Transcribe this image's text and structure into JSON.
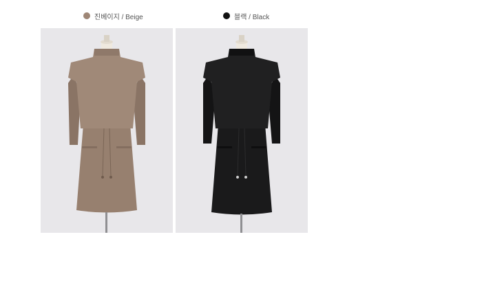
{
  "colors": [
    {
      "label": "진베이지 / Beige",
      "swatch": "#9e8676",
      "garment": "#97806f",
      "garment_dark": "#846e5f",
      "garment_light": "#a68f7e"
    },
    {
      "label": "블랙 / Black",
      "swatch": "#111111",
      "garment": "#1a1a1b",
      "garment_dark": "#0e0e0f",
      "garment_light": "#262627"
    }
  ],
  "background_color": "#e8e7ea",
  "mannequin_color": "#eee8de"
}
